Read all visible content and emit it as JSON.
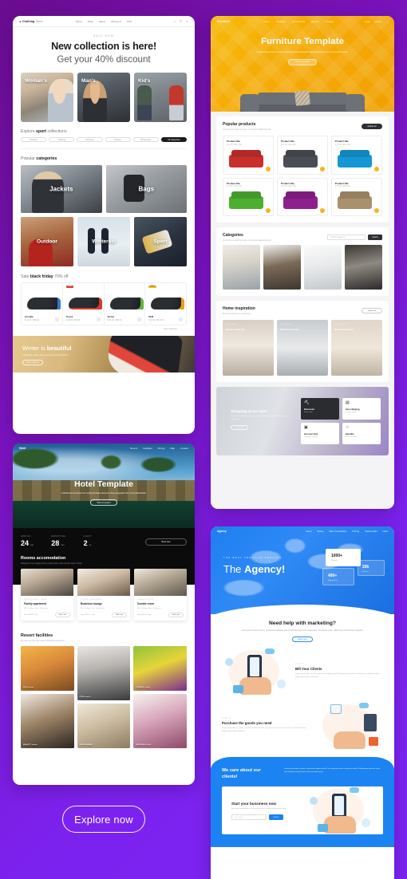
{
  "page": {
    "background_start": "#6a0d8f",
    "background_end": "#7c25f5",
    "explore_button": "Explore now"
  },
  "template_clothing": {
    "logo": "Clothing",
    "logo_sub": "Store",
    "menu": [
      "Home",
      "Shop",
      "Men's",
      "Women's",
      "Kids"
    ],
    "icons": [
      "search-icon",
      "cart-icon",
      "user-icon"
    ],
    "hero": {
      "kicker": "SALE NOW",
      "title": "New collection is here!",
      "subtitle": "Get your 40% discount"
    },
    "categories": [
      {
        "label": "Woman's"
      },
      {
        "label": "Man's"
      },
      {
        "label": "Kid's"
      }
    ],
    "explore": {
      "title_pre": "Explore ",
      "title_bold": "sport",
      "title_post": " collections",
      "pills": [
        "Outdoor",
        "Trekking",
        "Running",
        "Fitness",
        "Wintersport",
        "All categories"
      ]
    },
    "popular": {
      "title_pre": "Popular ",
      "title_bold": "categories",
      "tiles_big": [
        "Jackets",
        "Bags"
      ],
      "tiles_small": [
        "Outdoor",
        "Winterski",
        "Sport"
      ]
    },
    "sale": {
      "title_pre": "Sale ",
      "title_bold": "black friday",
      "title_post": " 70% off",
      "products": [
        {
          "name": "Croslite",
          "price": "$ 42.00 / $89.00",
          "badge": ""
        },
        {
          "name": "Terrex",
          "price": "$ 49.00 / $89.00",
          "badge": "NEW"
        },
        {
          "name": "Terrex",
          "price": "$ 51.00 / $99.00",
          "badge": ""
        },
        {
          "name": "Skill",
          "price": "$ 63.00 / $119.00",
          "badge": "SALE"
        }
      ],
      "more_link": "View collection"
    },
    "banner": {
      "title_pre": "Winter is ",
      "title_bold": "beautiful",
      "subtitle": "Lookbooks, trends and accessories for wintertime",
      "button": "Open collection"
    }
  },
  "template_furniture": {
    "logo": "Furniture",
    "menu": [
      "Home",
      "Furniture",
      "Accessories",
      "Kitchen",
      "Garage"
    ],
    "right_menu": [
      "Login",
      "Cart 0"
    ],
    "search_icon": "search-icon",
    "hero": {
      "title": "Furniture Template",
      "subtitle": "A slideshow component for cycling through elements. New paragraph line or text placeholder.",
      "button": "Start our project"
    },
    "popular": {
      "title": "Popular products",
      "subtitle": "Lorem ipsum dolor sit amet, consectetur adipiscing elit.",
      "button": "Explore all",
      "products": [
        {
          "title": "Product title",
          "price": "$ 17.00 / $29 USD",
          "color": "c-red"
        },
        {
          "title": "Product title",
          "price": "$ 13.00 / $29 USD",
          "color": "c-dark"
        },
        {
          "title": "Product title",
          "price": "$ 17.00 / $29 USD",
          "color": "c-blue"
        },
        {
          "title": "Product title",
          "price": "$ 23.00 / $39 USD",
          "color": "c-green"
        },
        {
          "title": "Product title",
          "price": "$ 13.00 / $29 USD",
          "color": "c-purple"
        },
        {
          "title": "Product title",
          "price": "$ 23.00 / $39 USD",
          "color": "c-brown"
        }
      ]
    },
    "categories": {
      "title": "Categories",
      "subtitle": "Lorem ipsum dolor sit amet, consectetur adipiscing elit.",
      "search_placeholder": "Search categories",
      "search_button": "Search",
      "tiles": [
        "living-room",
        "kitchen",
        "bathroom",
        "bedroom"
      ]
    },
    "inspiration": {
      "title": "Home inspiration",
      "subtitle": "See our products in real homes!",
      "button": "Explore all",
      "cards": [
        {
          "date": "26.01.2020",
          "title": "Quick brown fox"
        },
        {
          "date": "26.01.2020",
          "title": "Quick brown fox"
        },
        {
          "date": "26.01.2020",
          "title": "Quick brown fox"
        }
      ]
    },
    "footer": {
      "title": "Shopping at our store",
      "text": "Lorem ipsum dolor sit amet, consectetur adipiscing elit. Phasellus enim erat, vestibulum.",
      "button": "Read more",
      "features": [
        {
          "icon": "cart-icon",
          "title": "Discounts",
          "sub": "Every order",
          "dark": true
        },
        {
          "icon": "box-icon",
          "title": "Fast shipping",
          "sub": "On the request",
          "dark": false
        },
        {
          "icon": "lock-icon",
          "title": "Get your item",
          "sub": "Directly at catalog",
          "dark": false
        },
        {
          "icon": "star-icon",
          "title": "Benefits",
          "sub": "Free warranties",
          "dark": false
        }
      ]
    }
  },
  "template_hotel": {
    "logo": "Hotel",
    "menu": [
      "Rooms",
      "Facilities",
      "Pricing",
      "Map",
      "Contact"
    ],
    "hero": {
      "title": "Hotel Template",
      "subtitle": "A slideshow component for cycling through elements. New paragraph line or text placeholder.",
      "button": "Start our project"
    },
    "booking": {
      "fields": [
        {
          "label": "ARRIVAL",
          "value": "24",
          "unit": "Jan"
        },
        {
          "label": "DEPARTURE",
          "value": "28",
          "unit": "Jan"
        },
        {
          "label": "GUEST",
          "value": "2",
          "unit": "ps"
        }
      ],
      "button": "Book now"
    },
    "rooms": {
      "title": "Rooms accomodation",
      "subtitle": "Designed to see elegant decor, private place, relax and the style of hotel.",
      "cards": [
        {
          "kicker": "FROM 88 EUR / NIGHT",
          "name": "Family apartment",
          "amenities": "Wifi · Parking · Spa · Restaurant",
          "price": "From $88.00 / stay",
          "button": "Book now"
        },
        {
          "kicker": "LUXURY APARTMENT",
          "name": "Business lounge",
          "amenities": "Wifi · Parking · Spa · Restaurant",
          "price": "From $99.00 / stay",
          "button": "Book now"
        },
        {
          "kicker": "CLASSIC ROOM",
          "name": "Double room",
          "amenities": "Wifi · Parking · Spa · Restaurant",
          "price": "From $69.00 / stay",
          "button": "Book now"
        }
      ]
    },
    "facilities": {
      "title": "Resort facilities",
      "subtitle": "We have our own spa, salon and fitness experience.",
      "items": [
        {
          "caption": "SPA center",
          "class": "spa"
        },
        {
          "caption": "GYM center",
          "class": "gym"
        },
        {
          "caption": "FITNESS room",
          "class": "fit"
        },
        {
          "caption": "BEAUTY salon",
          "class": "beauty"
        },
        {
          "caption": "RESTAURANT",
          "class": "rest"
        },
        {
          "caption": "WEDDINGS hall",
          "class": "wed"
        }
      ]
    }
  },
  "template_agency": {
    "logo": "Agency",
    "menu": [
      "About",
      "Works",
      "Start Consultation",
      "Pricing",
      "Testimonials",
      "Links"
    ],
    "hero": {
      "kicker": "THE BEST CREATIVE SERVICE",
      "title_pre": "The ",
      "title_bold": "Agency!",
      "stats": [
        {
          "number": "1000+",
          "label": "Projects"
        },
        {
          "number": "20k",
          "label": "Reviews"
        },
        {
          "number": "400+",
          "label": "Happy clients"
        }
      ]
    },
    "marketing": {
      "title": "Need help with marketing?",
      "text": "Lorem ipsum dolor sit amet, consectetur adipiscing elit. Perspiciatis quis vitae consectetur, sit volutpat neque adipiscing metus laoreet molestias.",
      "button": "Read more"
    },
    "steps": [
      {
        "kicker": "STEP 1",
        "title": "Bill Your Clients",
        "text": "Lorem ipsum dolor sit amet, consectetur adipiscing elit. Perspiciatis quis vitae consectetur sit, volutpat neque adipisci quis laoreet molestias."
      },
      {
        "kicker": "STEP 2",
        "title": "Purchase the goods you need",
        "text": "Lorem ipsum dolor sit amet, consectetur adipiscing elit. Perspiciatis quis vitae consectetur sit, volutpat neque adipisci quis laoreet molestias."
      }
    ],
    "care": {
      "title": "We care about our clients!",
      "text": "Lorem ipsum dolor sit amet, consectetur adipiscing elit. Cras molestie metus a laoreet tincidunt. Pellentesque placerat, enim vitae tristique suscipit, lorem nulla venenatis purus."
    },
    "signup": {
      "title": "Start your bussiness now",
      "text": "Enter your registration to start your business today, attention and more.",
      "placeholder": "Your email",
      "button": "Submit"
    }
  }
}
